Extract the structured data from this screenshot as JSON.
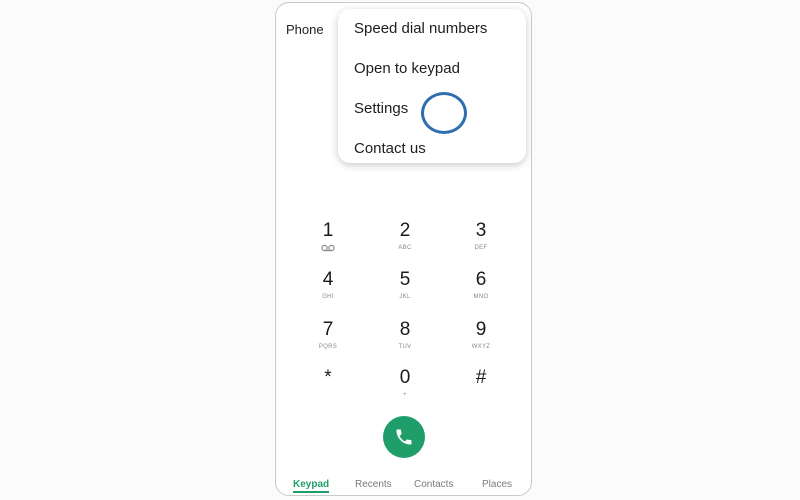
{
  "header": {
    "title": "Phone"
  },
  "menu": {
    "items": [
      {
        "label": "Speed dial numbers"
      },
      {
        "label": "Open to keypad"
      },
      {
        "label": "Settings"
      },
      {
        "label": "Contact us"
      }
    ],
    "highlighted_item": "Settings",
    "highlight_color": "#2f6fb0"
  },
  "keypad": {
    "keys": [
      {
        "digit": "1",
        "letters": "",
        "icon": "voicemail-icon"
      },
      {
        "digit": "2",
        "letters": "ABC"
      },
      {
        "digit": "3",
        "letters": "DEF"
      },
      {
        "digit": "4",
        "letters": "GHI"
      },
      {
        "digit": "5",
        "letters": "JKL"
      },
      {
        "digit": "6",
        "letters": "MNO"
      },
      {
        "digit": "7",
        "letters": "PQRS"
      },
      {
        "digit": "8",
        "letters": "TUV"
      },
      {
        "digit": "9",
        "letters": "WXYZ"
      },
      {
        "digit": "*",
        "letters": ""
      },
      {
        "digit": "0",
        "letters": "+"
      },
      {
        "digit": "#",
        "letters": ""
      }
    ]
  },
  "call_button": {
    "icon": "phone-icon",
    "color": "#1f9e6a"
  },
  "tabs": [
    {
      "label": "Keypad",
      "active": true
    },
    {
      "label": "Recents",
      "active": false
    },
    {
      "label": "Contacts",
      "active": false
    },
    {
      "label": "Places",
      "active": false
    }
  ],
  "colors": {
    "accent": "#1f9e6a"
  }
}
